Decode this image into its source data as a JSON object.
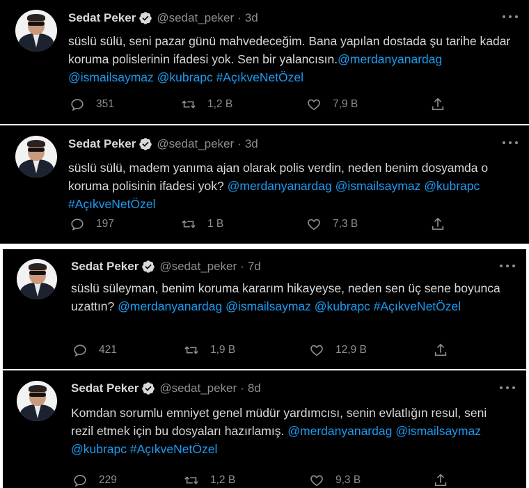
{
  "tweets": [
    {
      "name": "Sedat Peker",
      "handle": "@sedat_peker",
      "separator": "·",
      "time": "3d",
      "text_plain": "süslü sülü, seni pazar günü mahvedeceğim. Bana yapılan dostada şu tarihe kadar koruma polislerinin ifadesi yok. Sen bir yalancısın.",
      "mentions": [
        "@merdanyanardag",
        "@ismailsaymaz",
        "@kubrapc"
      ],
      "hashtag": "#AçıkveNetÖzel",
      "replies": "351",
      "retweets": "1,2 B",
      "likes": "7,9 B"
    },
    {
      "name": "Sedat Peker",
      "handle": "@sedat_peker",
      "separator": "·",
      "time": "3d",
      "text_plain": "süslü sülü, madem yanıma ajan olarak polis verdin, neden benim dosyamda o koruma polisinin ifadesi yok?",
      "mentions": [
        "@merdanyanardag",
        "@ismailsaymaz",
        "@kubrapc"
      ],
      "hashtag": "#AçıkveNetÖzel",
      "replies": "197",
      "retweets": "1 B",
      "likes": "7,3 B"
    },
    {
      "name": "Sedat Peker",
      "handle": "@sedat_peker",
      "separator": "·",
      "time": "7d",
      "text_plain": "süslü süleyman, benim koruma kararım hikayeyse, neden sen üç sene boyunca uzattın?",
      "mentions": [
        "@merdanyanardag",
        "@ismailsaymaz",
        "@kubrapc"
      ],
      "hashtag": "#AçıkveNetÖzel",
      "replies": "421",
      "retweets": "1,9 B",
      "likes": "12,9 B"
    },
    {
      "name": "Sedat Peker",
      "handle": "@sedat_peker",
      "separator": "·",
      "time": "8d",
      "text_plain": "Komdan sorumlu emniyet genel müdür yardımcısı, senin evlatlığın resul, seni rezil etmek için bu dosyaları hazırlamış.",
      "mentions": [
        "@merdanyanardag",
        "@ismailsaymaz",
        "@kubrapc"
      ],
      "hashtag": "#AçıkveNetÖzel",
      "replies": "229",
      "retweets": "1,2 B",
      "likes": "9,3 B"
    }
  ],
  "colors": {
    "background": "#000000",
    "text": "#d9d9d9",
    "muted": "#8b8f93",
    "link": "#1d9bf0"
  },
  "icons": [
    "verified-badge-icon",
    "more-icon",
    "reply-icon",
    "retweet-icon",
    "like-icon",
    "share-icon"
  ]
}
